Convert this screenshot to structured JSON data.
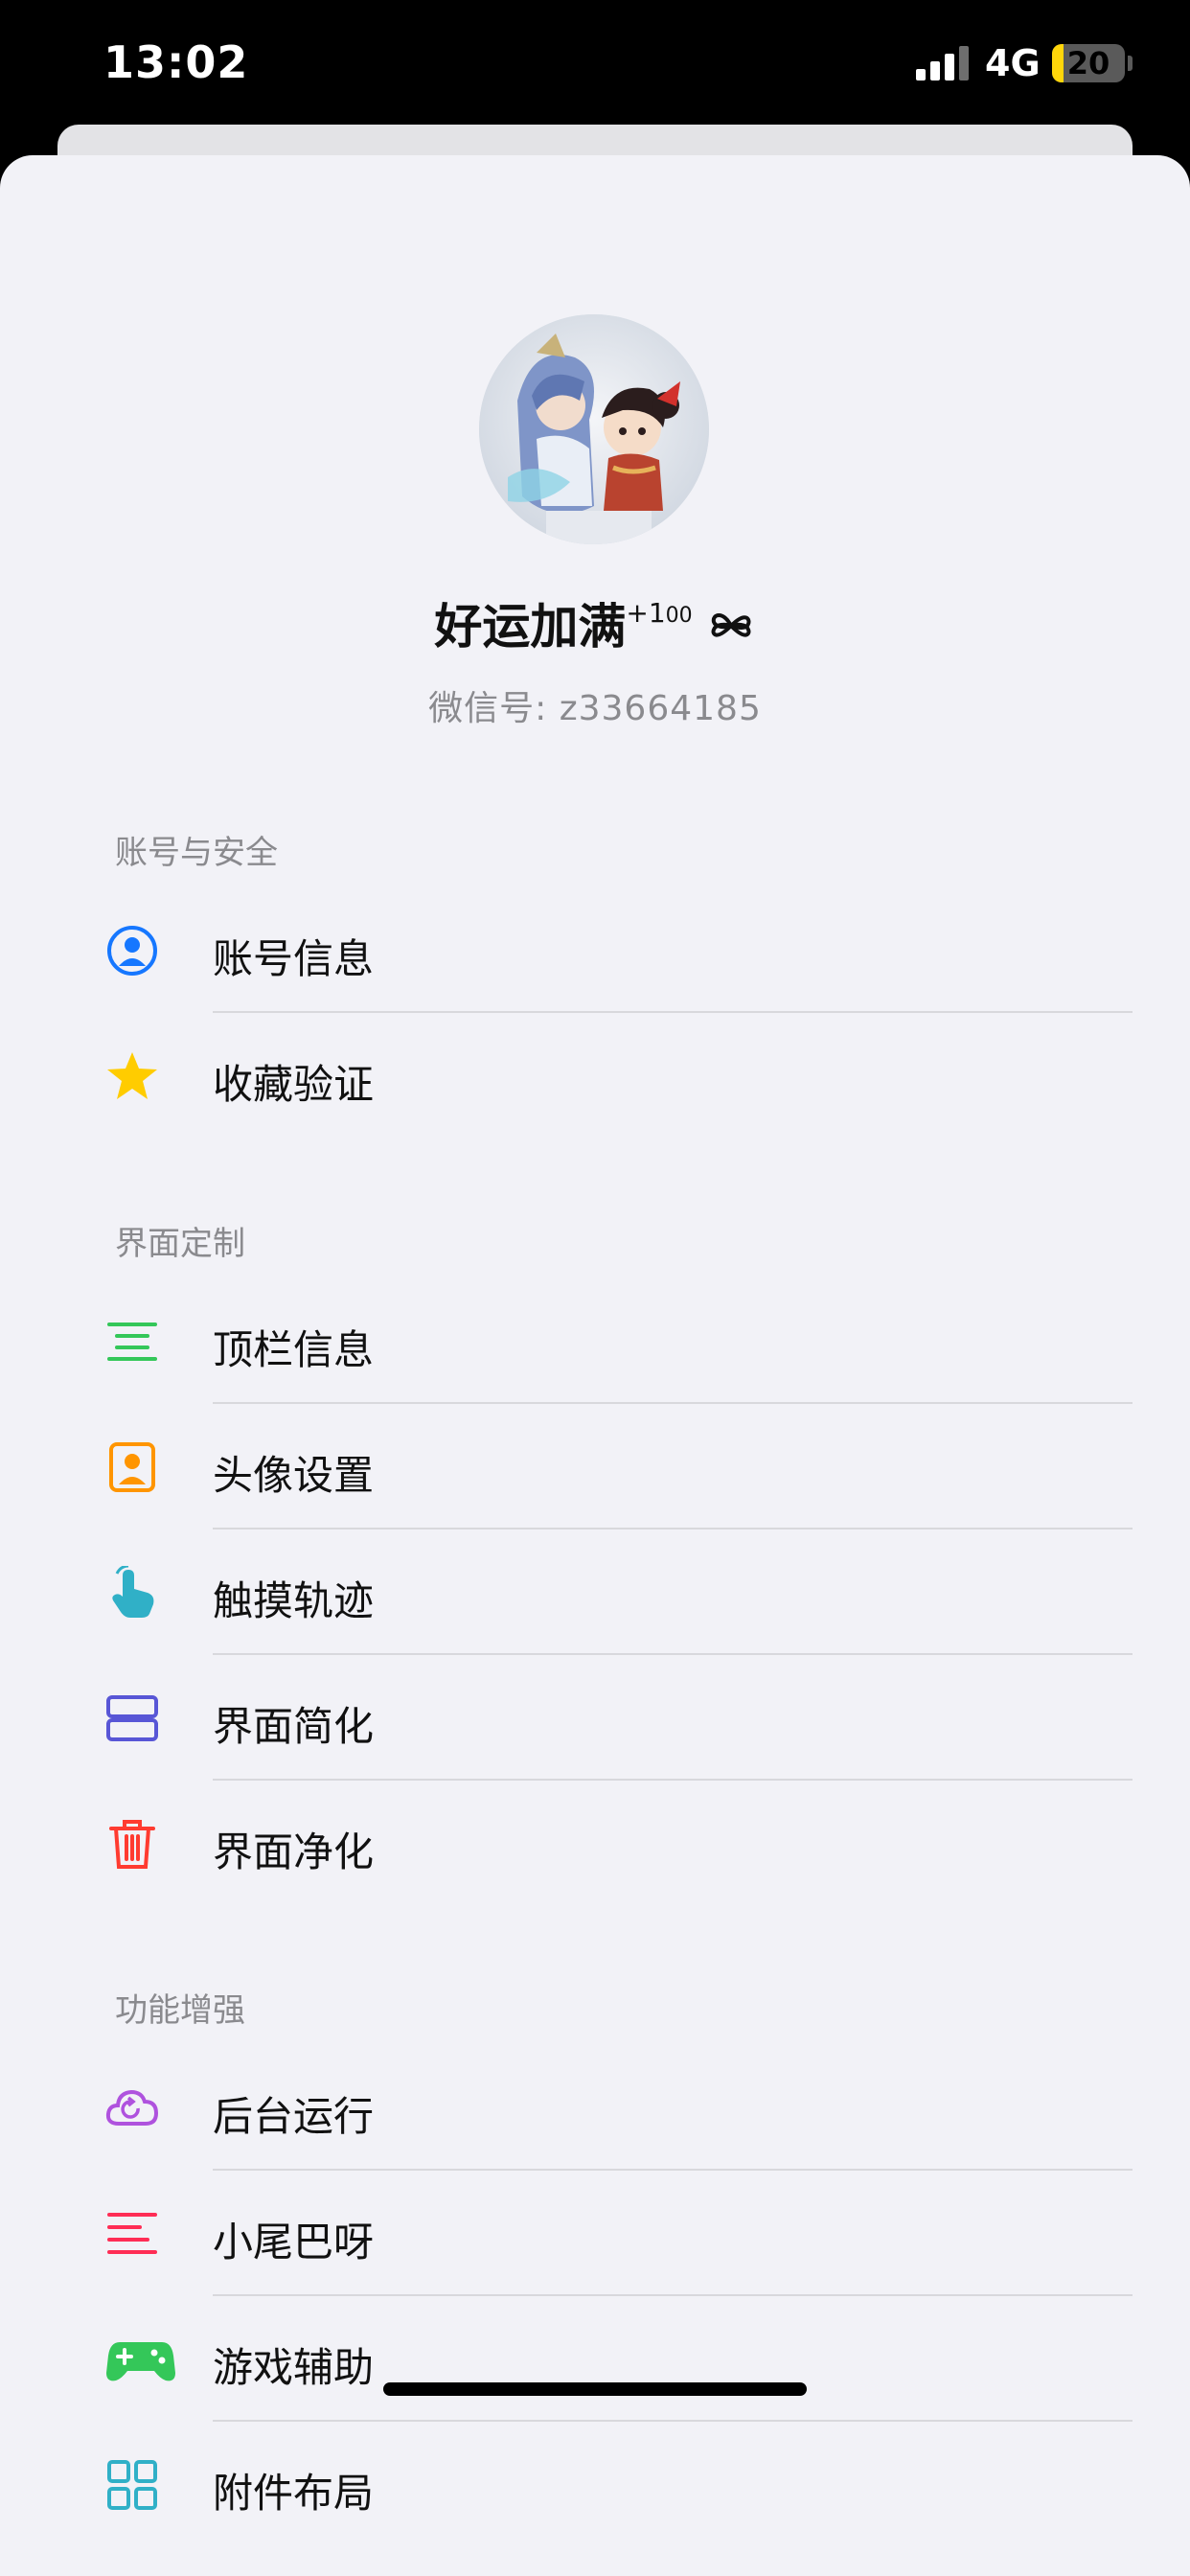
{
  "status_bar": {
    "time": "13:02",
    "network": "4G",
    "battery": "20"
  },
  "profile": {
    "nickname": "好运加满",
    "nickname_sup": "+1",
    "nickname_sup2": "00",
    "wechat_id": "微信号: z33664185"
  },
  "sections": [
    {
      "title": "账号与安全",
      "items": [
        {
          "label": "账号信息",
          "icon": "user-circle-icon",
          "color": "#1677ff"
        },
        {
          "label": "收藏验证",
          "icon": "star-icon",
          "color": "#ffcc00"
        }
      ]
    },
    {
      "title": "界面定制",
      "items": [
        {
          "label": "顶栏信息",
          "icon": "lines-icon",
          "color": "#34c759"
        },
        {
          "label": "头像设置",
          "icon": "portrait-icon",
          "color": "#ff9500"
        },
        {
          "label": "触摸轨迹",
          "icon": "touch-icon",
          "color": "#30b0c7"
        },
        {
          "label": "界面简化",
          "icon": "layout-rows-icon",
          "color": "#5856d6"
        },
        {
          "label": "界面净化",
          "icon": "trash-icon",
          "color": "#ff3b30"
        }
      ]
    },
    {
      "title": "功能增强",
      "items": [
        {
          "label": "后台运行",
          "icon": "cloud-refresh-icon",
          "color": "#af52de"
        },
        {
          "label": "小尾巴呀",
          "icon": "text-lines-icon",
          "color": "#ff2d55"
        },
        {
          "label": "游戏辅助",
          "icon": "gamepad-icon",
          "color": "#34c759"
        },
        {
          "label": "附件布局",
          "icon": "grid-icon",
          "color": "#30b0c7"
        }
      ]
    }
  ]
}
